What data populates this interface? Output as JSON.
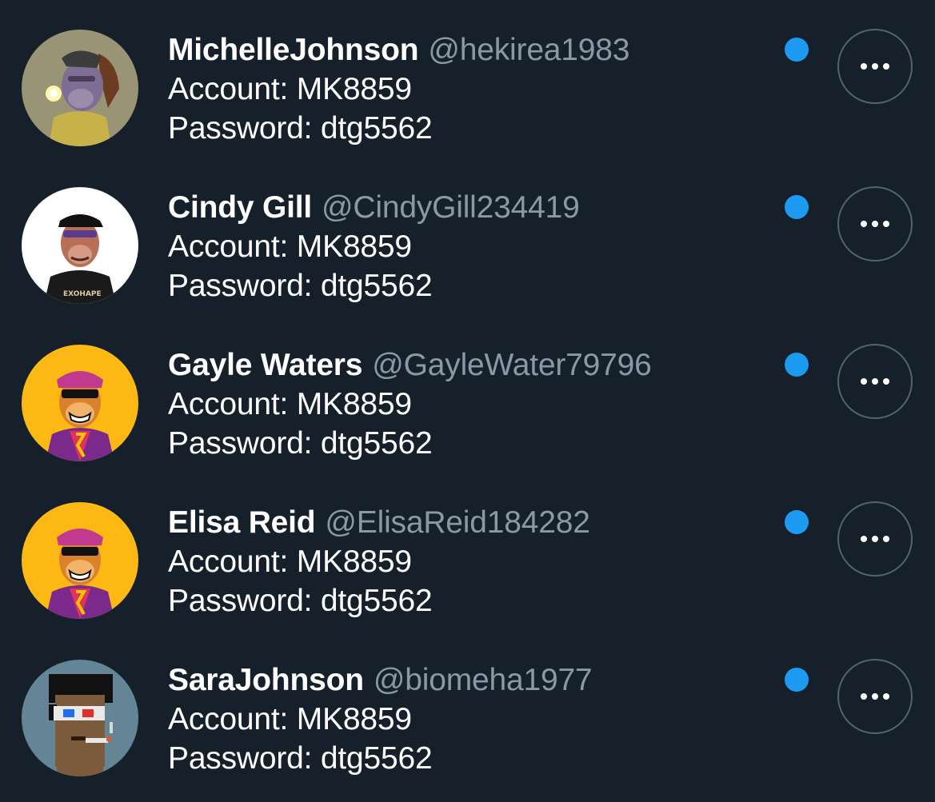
{
  "colors": {
    "background": "#15202b",
    "name_text": "#ffffff",
    "handle_text": "#8b98a5",
    "unread_dot": "#1d9bf0",
    "button_border": "#536471"
  },
  "accounts": [
    {
      "display_name": "MichelleJohnson",
      "handle": "@hekirea1983",
      "account_line": "Account: MK8859",
      "password_line": "Password: dtg5562",
      "avatar_icon": "ape-smoking-avatar-icon",
      "unread": true,
      "more_icon": "more-horizontal-icon"
    },
    {
      "display_name": "Cindy Gill",
      "handle": "@CindyGill234419",
      "account_line": "Account: MK8859",
      "password_line": "Password: dtg5562",
      "avatar_icon": "ape-cap-avatar-icon",
      "avatar_shirt_text": "EXOHAPE",
      "unread": true,
      "more_icon": "more-horizontal-icon"
    },
    {
      "display_name": "Gayle Waters",
      "handle": "@GayleWater79796",
      "account_line": "Account: MK8859",
      "password_line": "Password: dtg5562",
      "avatar_icon": "ape-sunglasses-avatar-icon",
      "unread": true,
      "more_icon": "more-horizontal-icon"
    },
    {
      "display_name": "Elisa Reid",
      "handle": "@ElisaReid184282",
      "account_line": "Account: MK8859",
      "password_line": "Password: dtg5562",
      "avatar_icon": "ape-sunglasses-avatar-icon",
      "unread": true,
      "more_icon": "more-horizontal-icon"
    },
    {
      "display_name": "SaraJohnson",
      "handle": "@biomeha1977",
      "account_line": "Account: MK8859",
      "password_line": "Password: dtg5562",
      "avatar_icon": "pixel-punk-avatar-icon",
      "unread": true,
      "more_icon": "more-horizontal-icon"
    }
  ]
}
